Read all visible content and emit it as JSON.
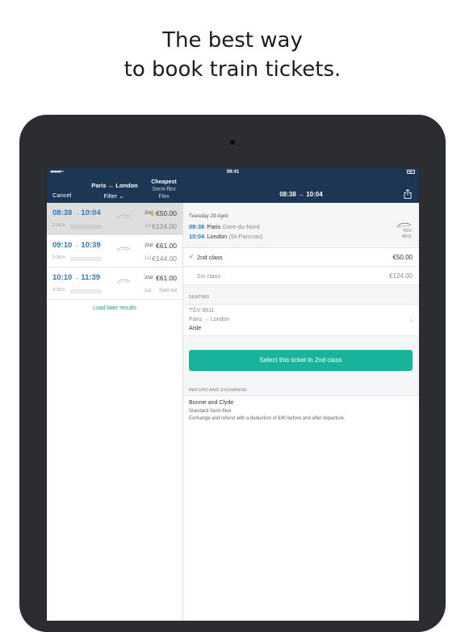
{
  "headline": {
    "line1": "The best way",
    "line2": "to book train tickets."
  },
  "status_bar": {
    "signal": "●●●●● ≈",
    "time": "09:41"
  },
  "navbar": {
    "cancel": "Cancel",
    "route": "Paris ↔ London",
    "filter": "Filter ⌄",
    "sort_label": "Cheapest",
    "fare_line1": "Semi-flex",
    "fare_line2": "Flex",
    "title": "08:38 → 10:04"
  },
  "trips": [
    {
      "depart": "08:38",
      "arrive": "10:04",
      "duration": "2:26 h",
      "class2": "2nd",
      "price2": "€50.00",
      "class1": "1st",
      "price1": "€124.00",
      "cheapest": true,
      "selected": true
    },
    {
      "depart": "09:10",
      "arrive": "10:39",
      "duration": "2:29 h",
      "class2": "2nd",
      "price2": "€61.00",
      "class1": "1st",
      "price1": "€144.00"
    },
    {
      "depart": "10:10",
      "arrive": "11:39",
      "duration": "2:29 h",
      "class2": "2nd",
      "price2": "€61.00",
      "class1": "1st",
      "price1": "Sold out"
    }
  ],
  "load_later": "Load later results",
  "detail": {
    "date": "Tuesday 29 April",
    "dep_time": "08:38",
    "dep_city": "Paris",
    "dep_station": "Gare-du-Nord",
    "arr_time": "10:04",
    "arr_city": "London",
    "arr_station": "(St-Pancras)",
    "train_type": "TGV",
    "train_number": "8611",
    "classes": [
      {
        "label": "2nd class",
        "price": "€50.00",
        "selected": true
      },
      {
        "label": "1st class",
        "price": "€124.00",
        "selected": false
      }
    ],
    "seating_header": "SEATING",
    "seating_train": "TGV 8611",
    "seating_route": "Paris → London",
    "seating_pref": "Aisle",
    "select_button": "Select this ticket in 2nd class",
    "refund_header": "REFUND AND EXCHANGE",
    "refund_name": "Bonnie and Clyde",
    "refund_fare": "Standard Semi-flexi",
    "refund_conditions": "Exchange and refund with a deduction of €40 before and after departure."
  },
  "colors": {
    "navbar": "#1c3654",
    "accent_green": "#17b39a",
    "time_blue": "#2e79c4",
    "cheapest_dot": "#f0b431"
  }
}
